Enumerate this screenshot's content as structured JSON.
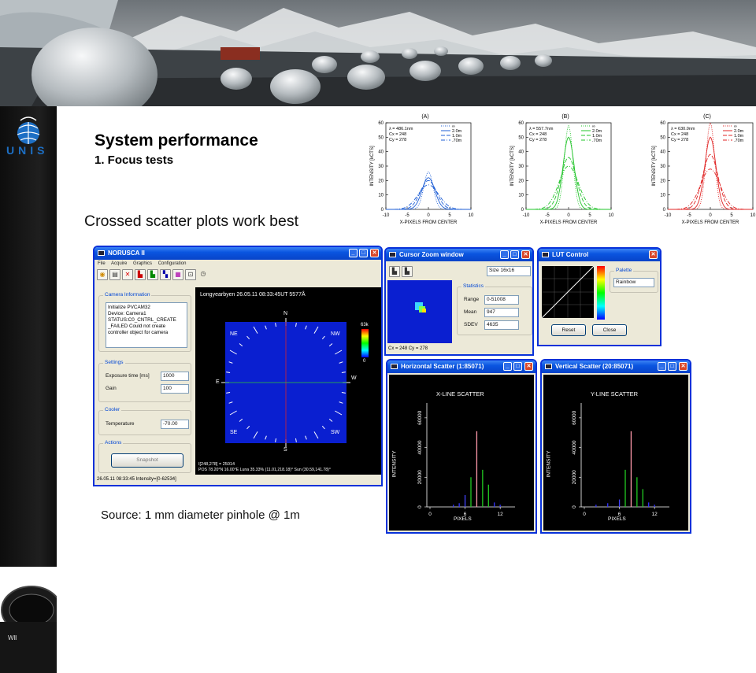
{
  "slide": {
    "title": "System performance",
    "subtitle": "1. Focus tests",
    "headline": "Crossed scatter plots work best",
    "source": "Source: 1 mm diameter pinhole @ 1m",
    "logo_text": "UNIS"
  },
  "plots": [
    {
      "label": "(A)",
      "lambda": "λ = 486.1nm",
      "cx": "Cx = 248",
      "cy": "Cy = 278",
      "color": "#1f5fd6"
    },
    {
      "label": "(B)",
      "lambda": "λ = 557.7nm",
      "cx": "Cx = 248",
      "cy": "Cy = 278",
      "color": "#22c42a"
    },
    {
      "label": "(C)",
      "lambda": "λ = 630.0nm",
      "cx": "Cx = 248",
      "cy": "Cy = 278",
      "color": "#e02525"
    }
  ],
  "plot_common": {
    "ylabel": "INTENSITY [kCTS]",
    "xlabel": "X-PIXELS FROM CENTER",
    "yticks": [
      "0",
      "10",
      "20",
      "30",
      "40",
      "50",
      "60"
    ],
    "xticks": [
      "-10",
      "-5",
      "0",
      "5",
      "10"
    ],
    "legend": [
      "∞",
      "2.0m",
      "1.0m",
      ".70m"
    ]
  },
  "norusca": {
    "title": "NORUSCA II",
    "menu": [
      "File",
      "Acquire",
      "Graphics",
      "Configuration"
    ],
    "camera_info_label": "Camera Information",
    "camera_info_lines": [
      "Initialize PVCAM32",
      "Device: Camera1",
      "STATUS:C0_CNTRL_CREATE",
      "_FAILED   Could not create",
      "controller object for camera"
    ],
    "settings_label": "Settings",
    "exposure_label": "Exposure time [ms]",
    "exposure_value": "1000",
    "gain_label": "Gain",
    "gain_value": "100",
    "cooler_label": "Cooler",
    "temp_label": "Temperature",
    "temp_value": "-70.00",
    "actions_label": "Actions",
    "snapshot_label": "Snapshot",
    "image_header": "Longyearbyen 26.05.11 08:33:45UT 5577Å",
    "compass": {
      "n": "N",
      "s": "S",
      "e": "E",
      "w": "W",
      "ne": "NE",
      "nw": "NW",
      "se": "SE",
      "sw": "SW"
    },
    "scale_max": "63k",
    "scale_min": "0",
    "pixel_readout": "I[248,278] = 25014",
    "pos_readout": "POS 78.20°N  16.00°E  Luna 35.33% (11.01,218.18)°  Sun (30.59,141.78)°",
    "status_bar": "26.05.11 08:33:45 Intensity=[0-62534]"
  },
  "zoom": {
    "title": "Cursor Zoom window",
    "size_option": "Size 16x16",
    "statistics_label": "Statistics",
    "range_label": "Range",
    "range_value": "0-51008",
    "mean_label": "Mean",
    "mean_value": "947",
    "sdev_label": "SDEV",
    "sdev_value": "4635",
    "cursor_text": "Cx = 248 Cy = 278"
  },
  "lut": {
    "title": "LUT Control",
    "palette_label": "Palette",
    "palette_value": "Rainbow",
    "reset_label": "Reset",
    "close_label": "Close"
  },
  "hscatter": {
    "title": "Horizontal Scatter (1:85071)",
    "heading": "X-LINE SCATTER",
    "ylabel": "INTENSITY",
    "xlabel": "PIXELS",
    "yticks": [
      "0",
      "20000",
      "40000",
      "60000"
    ],
    "xticks": [
      "0",
      "6",
      "12"
    ]
  },
  "vscatter": {
    "title": "Vertical Scatter (20:85071)",
    "heading": "Y-LINE SCATTER",
    "ylabel": "INTENSITY",
    "xlabel": "PIXELS",
    "yticks": [
      "0",
      "20000",
      "40000",
      "60000"
    ],
    "xticks": [
      "0",
      "6",
      "12"
    ]
  }
}
